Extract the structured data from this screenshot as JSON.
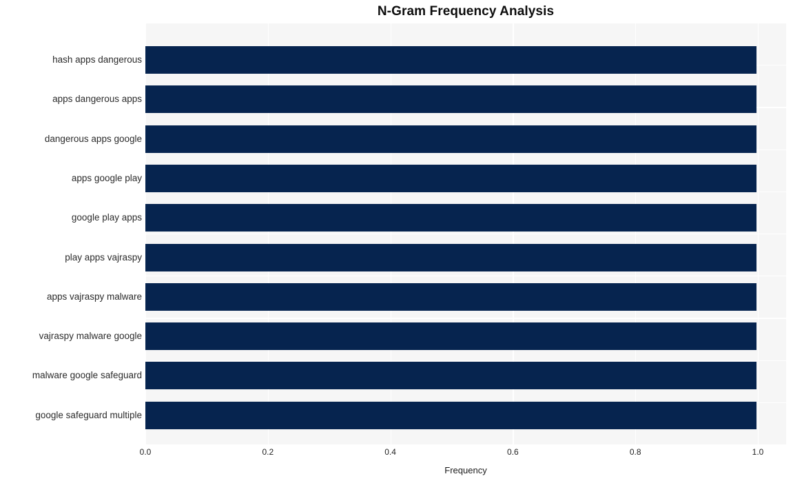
{
  "chart_data": {
    "type": "bar",
    "orientation": "horizontal",
    "title": "N-Gram Frequency Analysis",
    "xlabel": "Frequency",
    "ylabel": "",
    "categories": [
      "hash apps dangerous",
      "apps dangerous apps",
      "dangerous apps google",
      "apps google play",
      "google play apps",
      "play apps vajraspy",
      "apps vajraspy malware",
      "vajraspy malware google",
      "malware google safeguard",
      "google safeguard multiple"
    ],
    "values": [
      1.0,
      1.0,
      1.0,
      1.0,
      1.0,
      1.0,
      1.0,
      1.0,
      1.0,
      1.0
    ],
    "xlim": [
      0.0,
      1.0
    ],
    "xticks": [
      0.0,
      0.2,
      0.4,
      0.6,
      0.8,
      1.0
    ],
    "xtick_labels": [
      "0.0",
      "0.2",
      "0.4",
      "0.6",
      "0.8",
      "1.0"
    ],
    "grid": true,
    "legend": null,
    "bar_color": "#06244f",
    "plot_background": "#f6f6f6",
    "grid_color": "#ffffff",
    "figure_background": "#ffffff"
  }
}
